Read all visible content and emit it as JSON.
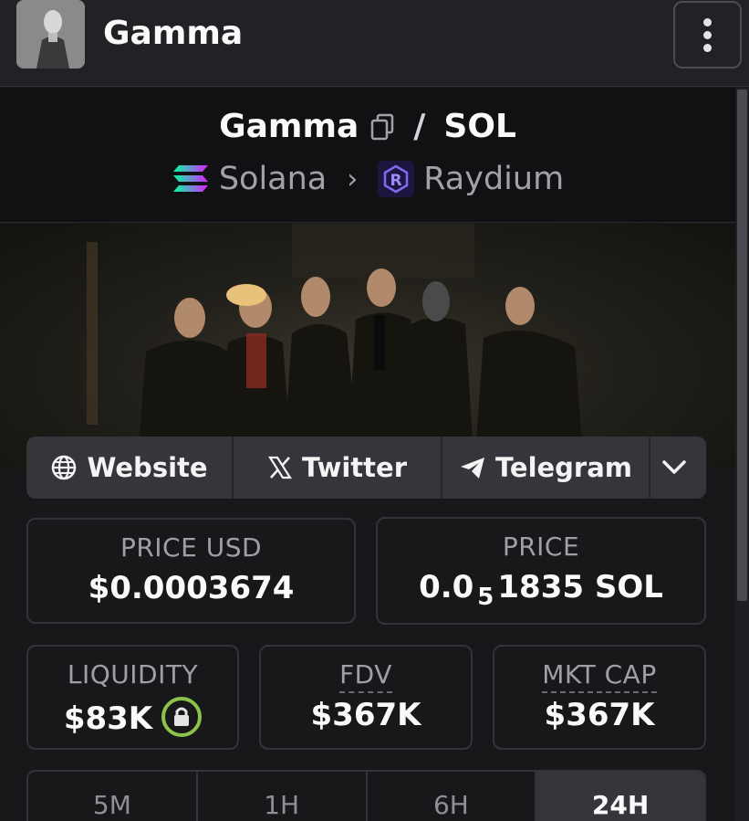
{
  "header": {
    "title": "Gamma",
    "menu_icon": "vertical-dots-icon"
  },
  "pair": {
    "base": "Gamma",
    "quote": "SOL",
    "chain": "Solana",
    "dex": "Raydium"
  },
  "links": {
    "website": "Website",
    "twitter": "Twitter",
    "telegram": "Telegram"
  },
  "stats": {
    "price_usd_label": "PRICE USD",
    "price_usd_value": "$0.0003674",
    "price_label": "PRICE",
    "price_prefix": "0.0",
    "price_zero_count": "5",
    "price_digits": "1835 SOL",
    "liquidity_label": "LIQUIDITY",
    "liquidity_value": "$83K",
    "fdv_label": "FDV",
    "fdv_value": "$367K",
    "mktcap_label": "MKT CAP",
    "mktcap_value": "$367K"
  },
  "timeframes": [
    "5M",
    "1H",
    "6H",
    "24H"
  ],
  "active_timeframe": "24H",
  "colors": {
    "accent_lock": "#8bc34a",
    "background": "#18181b"
  }
}
